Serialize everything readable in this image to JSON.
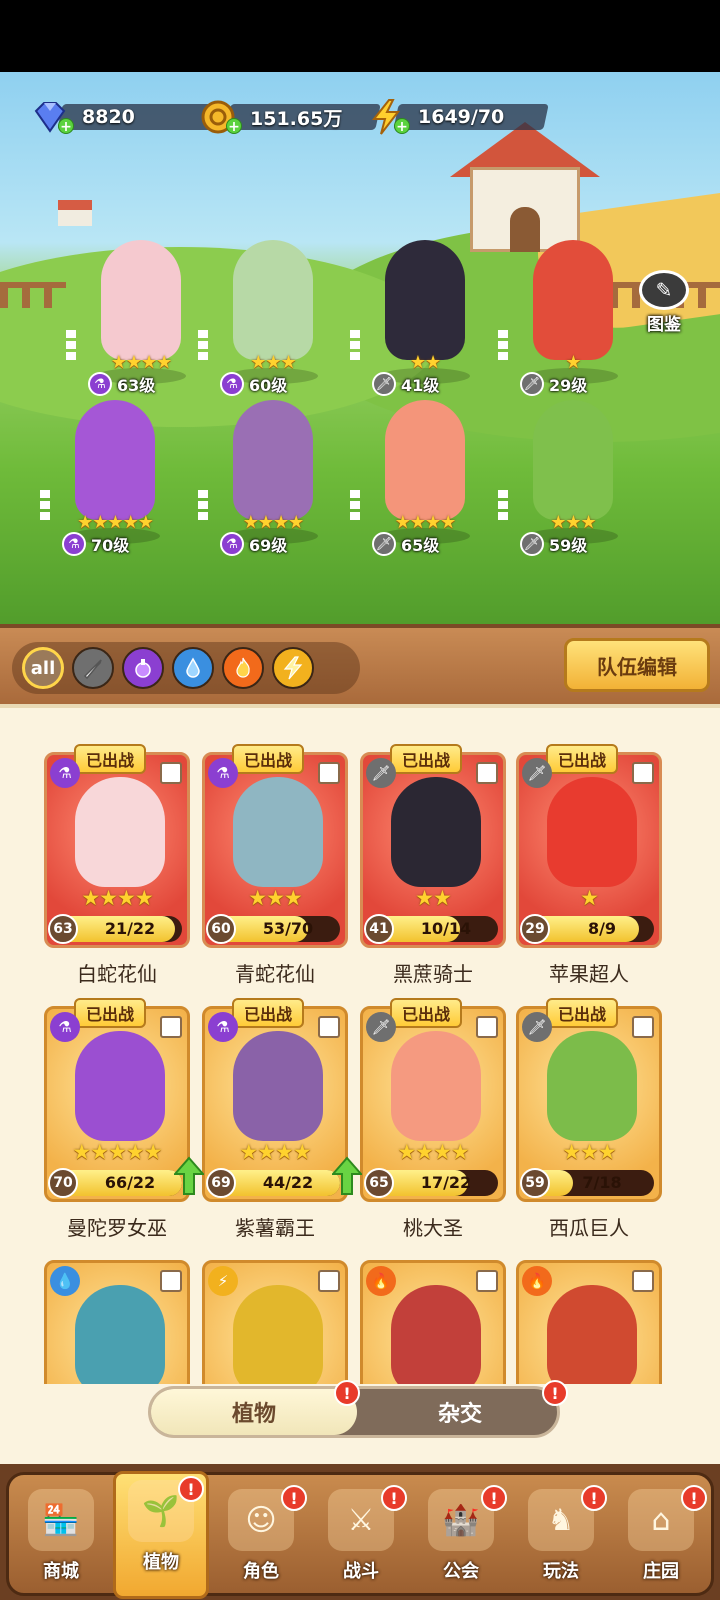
{
  "resources": {
    "gems": "8820",
    "gold": "151.65万",
    "energy": "1649/70"
  },
  "atlas_label": "图鉴",
  "field_units": [
    {
      "level": "63级",
      "stars": "★★★★",
      "element": "poison"
    },
    {
      "level": "60级",
      "stars": "★★★",
      "element": "poison"
    },
    {
      "level": "41级",
      "stars": "★★",
      "element": "sword"
    },
    {
      "level": "29级",
      "stars": "★",
      "element": "sword"
    },
    {
      "level": "70级",
      "stars": "★★★★★",
      "element": "poison"
    },
    {
      "level": "69级",
      "stars": "★★★★",
      "element": "poison"
    },
    {
      "level": "65级",
      "stars": "★★★★",
      "element": "sword"
    },
    {
      "level": "59级",
      "stars": "★★★",
      "element": "sword"
    }
  ],
  "filters": {
    "all_label": "all",
    "icons": [
      "sword-icon",
      "poison-icon",
      "water-icon",
      "fire-icon",
      "lightning-icon"
    ]
  },
  "team_edit_label": "队伍编辑",
  "deployed_label": "已出战",
  "cards": [
    {
      "name": "白蛇花仙",
      "level": "63",
      "count": "21/22",
      "stars": "★★★★",
      "fill": 0.95,
      "element": "poison",
      "style": "red"
    },
    {
      "name": "青蛇花仙",
      "level": "60",
      "count": "53/70",
      "stars": "★★★",
      "fill": 0.76,
      "element": "poison",
      "style": "red"
    },
    {
      "name": "黑蔗骑士",
      "level": "41",
      "count": "10/14",
      "stars": "★★",
      "fill": 0.71,
      "element": "sword",
      "style": "red"
    },
    {
      "name": "苹果超人",
      "level": "29",
      "count": "8/9",
      "stars": "★",
      "fill": 0.89,
      "element": "sword",
      "style": "red"
    },
    {
      "name": "曼陀罗女巫",
      "level": "70",
      "count": "66/22",
      "stars": "★★★★★",
      "fill": 1.0,
      "element": "poison",
      "style": "gold",
      "upgrade": true
    },
    {
      "name": "紫薯霸王",
      "level": "69",
      "count": "44/22",
      "stars": "★★★★",
      "fill": 1.0,
      "element": "poison",
      "style": "gold",
      "upgrade": true
    },
    {
      "name": "桃大圣",
      "level": "65",
      "count": "17/22",
      "stars": "★★★★",
      "fill": 0.77,
      "element": "sword",
      "style": "gold"
    },
    {
      "name": "西瓜巨人",
      "level": "59",
      "count": "7/18",
      "stars": "★★★",
      "fill": 0.39,
      "element": "sword",
      "style": "gold"
    }
  ],
  "partial_cards": [
    {
      "element": "water"
    },
    {
      "element": "lightning"
    },
    {
      "element": "fire"
    },
    {
      "element": "fire"
    }
  ],
  "toggle": {
    "left": "植物",
    "right": "杂交",
    "badge": "!"
  },
  "nav": [
    {
      "label": "商城",
      "icon": "shop-icon",
      "badge": false
    },
    {
      "label": "植物",
      "icon": "plant-icon",
      "badge": true,
      "active": true
    },
    {
      "label": "角色",
      "icon": "character-icon",
      "badge": true
    },
    {
      "label": "战斗",
      "icon": "battle-icon",
      "badge": true
    },
    {
      "label": "公会",
      "icon": "guild-icon",
      "badge": true
    },
    {
      "label": "玩法",
      "icon": "gameplay-icon",
      "badge": true
    },
    {
      "label": "庄园",
      "icon": "manor-icon",
      "badge": true
    }
  ],
  "colors": {
    "poison": "#8b3fd1",
    "sword": "#6f6f6f",
    "water": "#3a8fe0",
    "fire": "#f26a1b",
    "lightning": "#f2b11e"
  }
}
